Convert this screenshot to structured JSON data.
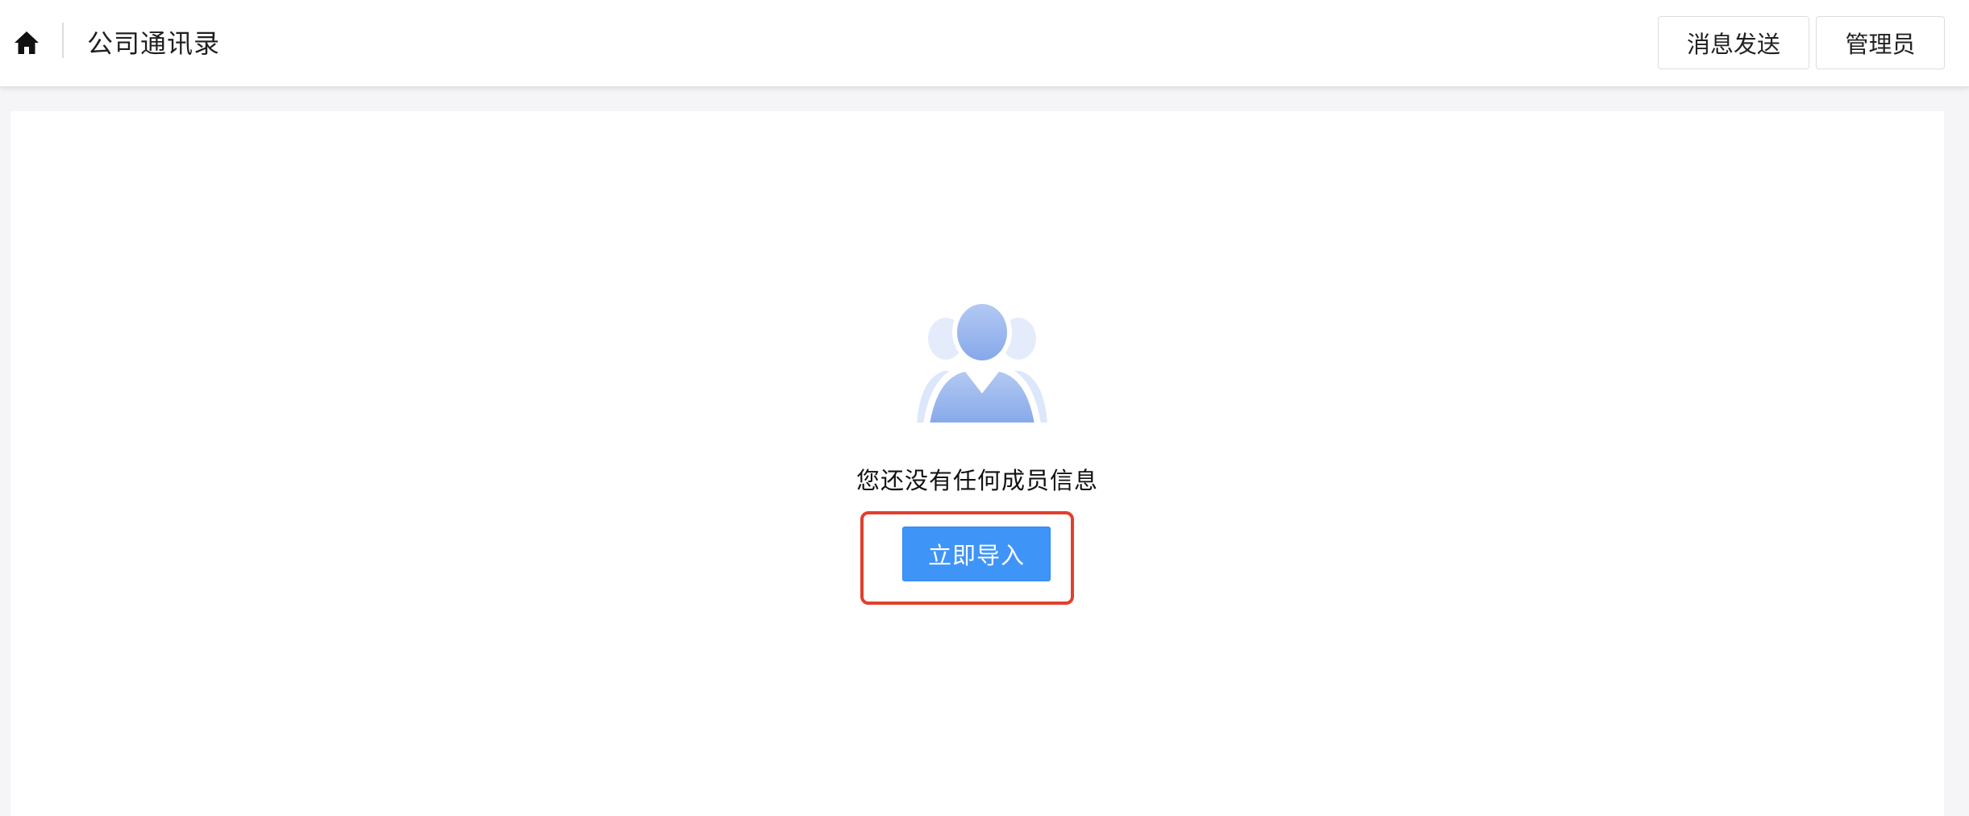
{
  "header": {
    "title": "公司通讯录",
    "home_icon": "home-icon",
    "buttons": {
      "message_label": "消息发送",
      "admin_label": "管理员"
    }
  },
  "empty_state": {
    "illustration_icon": "people-group-icon",
    "message": "您还没有任何成员信息",
    "import_label": "立即导入"
  },
  "colors": {
    "primary_button": "#3f94f7",
    "highlight_border": "#e0402d",
    "illustration_main": "#8fb0ec",
    "illustration_back": "#dbe6fb"
  }
}
